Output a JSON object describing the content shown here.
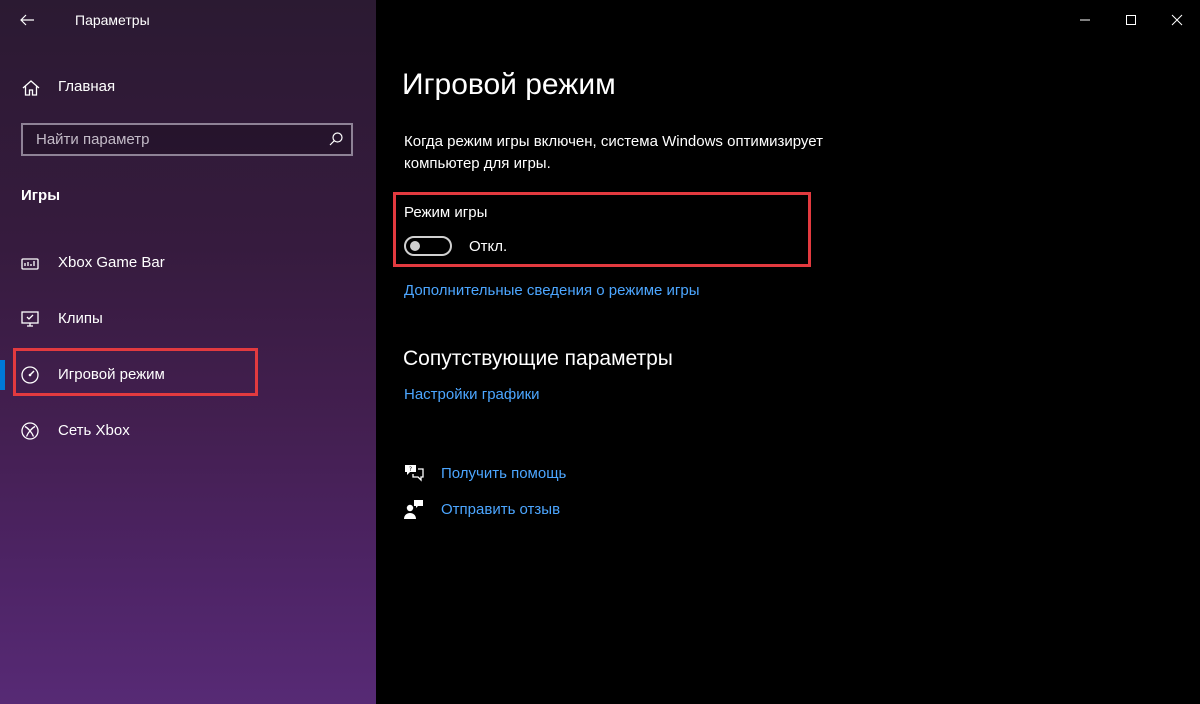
{
  "window": {
    "title": "Параметры",
    "controls": [
      "minimize",
      "maximize",
      "close"
    ]
  },
  "sidebar": {
    "home_label": "Главная",
    "search": {
      "placeholder": "Найти параметр",
      "value": ""
    },
    "section_title": "Игры",
    "items": [
      {
        "label": "Xbox Game Bar",
        "icon": "xbox-game-bar-icon",
        "selected": false
      },
      {
        "label": "Клипы",
        "icon": "clips-icon",
        "selected": false
      },
      {
        "label": "Игровой режим",
        "icon": "game-mode-icon",
        "selected": true
      },
      {
        "label": "Сеть Xbox",
        "icon": "xbox-icon",
        "selected": false
      }
    ]
  },
  "main": {
    "title": "Игровой режим",
    "description": "Когда режим игры включен, система Windows оптимизирует компьютер для игры.",
    "toggle": {
      "label": "Режим игры",
      "state_text": "Откл.",
      "on": false
    },
    "more_info_link": "Дополнительные сведения о режиме игры",
    "related": {
      "title": "Сопутствующие параметры",
      "graphics_link": "Настройки графики"
    },
    "help": {
      "get_help": "Получить помощь",
      "feedback": "Отправить отзыв"
    }
  },
  "colors": {
    "accent": "#0078d7",
    "link": "#4ca6ff",
    "highlight": "#e23a3f"
  }
}
